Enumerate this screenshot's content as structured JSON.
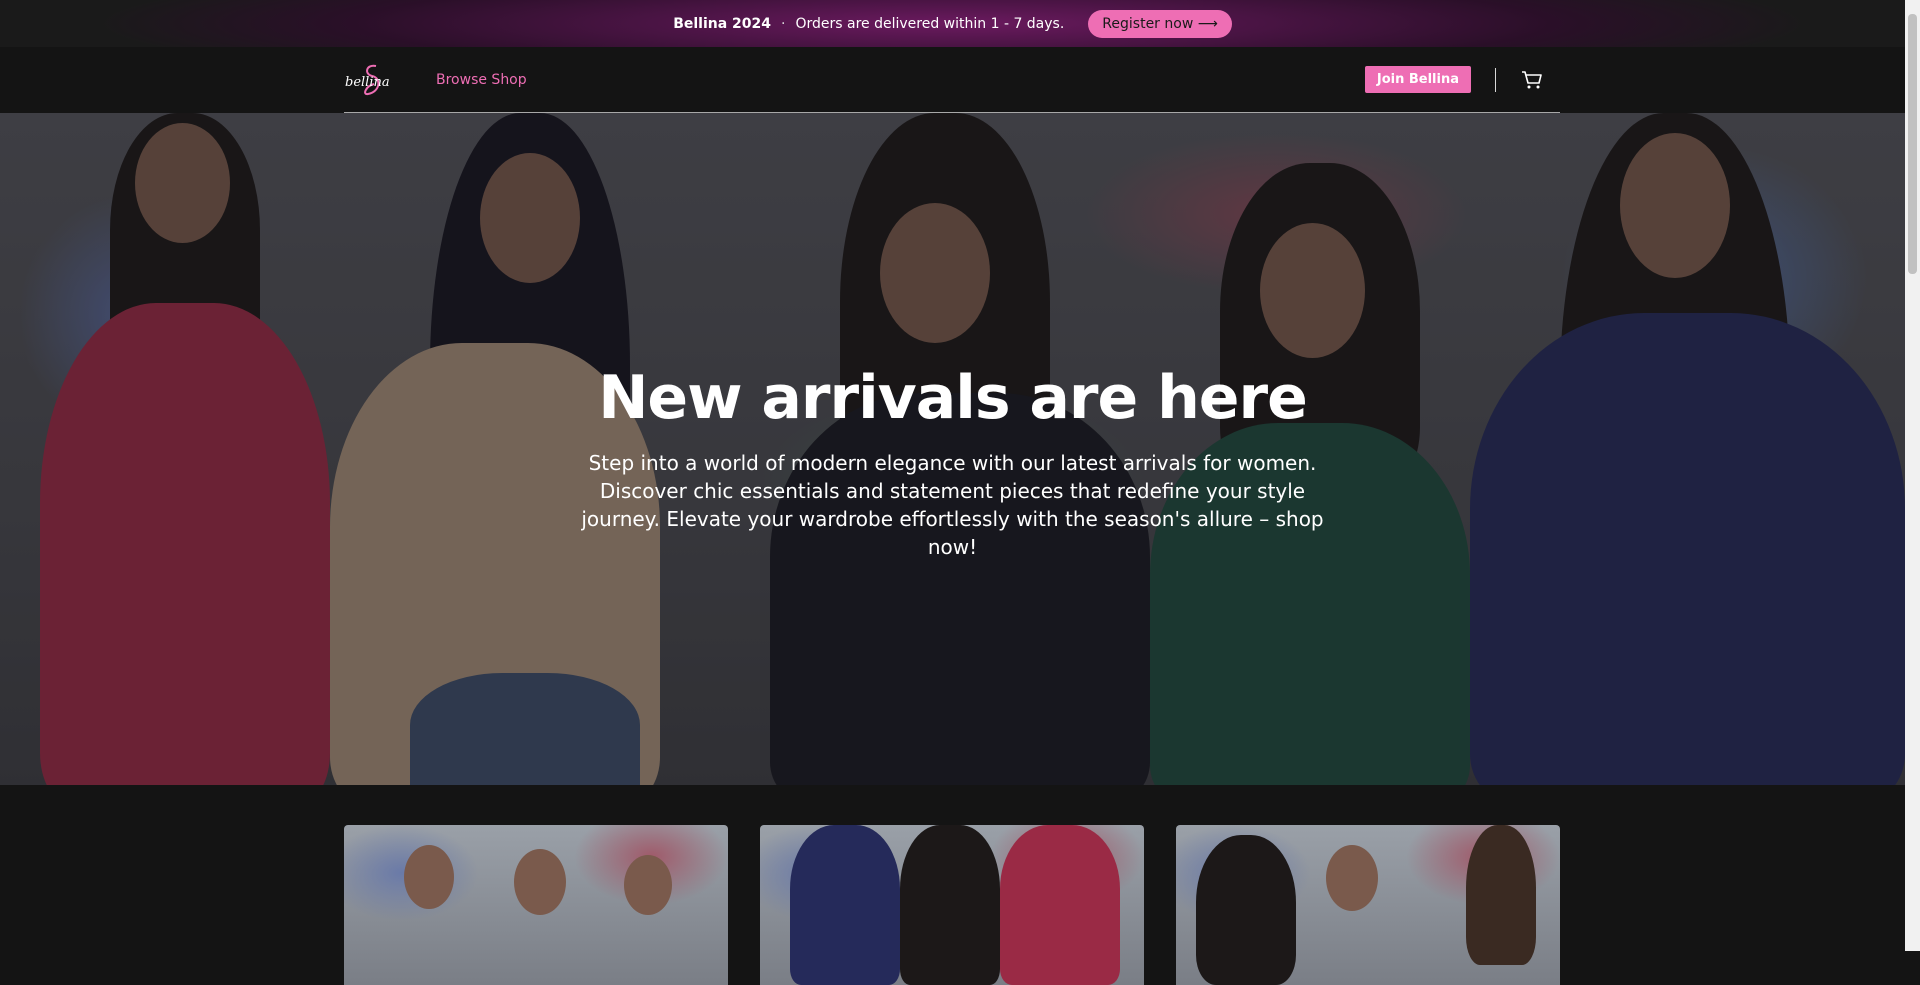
{
  "announcement": {
    "brand": "Bellina 2024",
    "separator": "·",
    "message": "Orders are delivered within 1 - 7 days.",
    "register_label": "Register now ⟶"
  },
  "nav": {
    "logo_text": "bellina",
    "browse_label": "Browse Shop",
    "join_label": "Join Bellina"
  },
  "hero": {
    "title": "New arrivals are here",
    "subtitle": "Step into a world of modern elegance with our latest arrivals for women. Discover chic essentials and statement pieces that redefine your style journey. Elevate your wardrobe effortlessly with the season's allure – shop now!"
  },
  "colors": {
    "accent": "#ee6eb4",
    "background": "#141414"
  },
  "icons": {
    "cart": "cart-icon"
  }
}
